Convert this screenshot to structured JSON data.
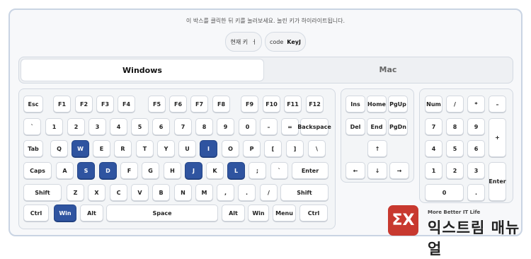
{
  "instruction": "이 박스를 클릭한 뒤 키를 눌러보세요. 눌린 키가 하이라이트됩니다.",
  "current_key_label": "현재 키",
  "current_key_value": "ㅓ",
  "code_label": "code",
  "code_value": "KeyJ",
  "tabs": {
    "active": "Windows",
    "inactive": "Mac"
  },
  "brand": {
    "logo_text": "ΣX",
    "tagline": "More Better IT Life",
    "name": "익스트림 매뉴얼"
  },
  "highlight_color": "#2f54a0",
  "main_keys": [
    {
      "label": "Esc",
      "name": "key-esc"
    },
    {
      "label": "F1",
      "name": "key-f1"
    },
    {
      "label": "F2",
      "name": "key-f2"
    },
    {
      "label": "F3",
      "name": "key-f3"
    },
    {
      "label": "F4",
      "name": "key-f4"
    },
    {
      "label": "F5",
      "name": "key-f5"
    },
    {
      "label": "F6",
      "name": "key-f6"
    },
    {
      "label": "F7",
      "name": "key-f7"
    },
    {
      "label": "F8",
      "name": "key-f8"
    },
    {
      "label": "F9",
      "name": "key-f9"
    },
    {
      "label": "F10",
      "name": "key-f10"
    },
    {
      "label": "F11",
      "name": "key-f11"
    },
    {
      "label": "F12",
      "name": "key-f12"
    },
    {
      "label": "`",
      "name": "key-backquote"
    },
    {
      "label": "1",
      "name": "key-1"
    },
    {
      "label": "2",
      "name": "key-2"
    },
    {
      "label": "3",
      "name": "key-3"
    },
    {
      "label": "4",
      "name": "key-4"
    },
    {
      "label": "5",
      "name": "key-5"
    },
    {
      "label": "6",
      "name": "key-6"
    },
    {
      "label": "7",
      "name": "key-7"
    },
    {
      "label": "8",
      "name": "key-8"
    },
    {
      "label": "9",
      "name": "key-9"
    },
    {
      "label": "0",
      "name": "key-0"
    },
    {
      "label": "–",
      "name": "key-minus"
    },
    {
      "label": "=",
      "name": "key-equal"
    },
    {
      "label": "Backspace",
      "name": "key-backspace"
    },
    {
      "label": "Tab",
      "name": "key-tab"
    },
    {
      "label": "Q",
      "name": "key-q"
    },
    {
      "label": "W",
      "name": "key-w",
      "highlight": true
    },
    {
      "label": "E",
      "name": "key-e"
    },
    {
      "label": "R",
      "name": "key-r"
    },
    {
      "label": "T",
      "name": "key-t"
    },
    {
      "label": "Y",
      "name": "key-y"
    },
    {
      "label": "U",
      "name": "key-u"
    },
    {
      "label": "I",
      "name": "key-i",
      "highlight": true
    },
    {
      "label": "O",
      "name": "key-o"
    },
    {
      "label": "P",
      "name": "key-p"
    },
    {
      "label": "[",
      "name": "key-bracket-left"
    },
    {
      "label": "]",
      "name": "key-bracket-right"
    },
    {
      "label": "\\",
      "name": "key-backslash"
    },
    {
      "label": "Caps",
      "name": "key-caps"
    },
    {
      "label": "A",
      "name": "key-a"
    },
    {
      "label": "S",
      "name": "key-s",
      "highlight": true
    },
    {
      "label": "D",
      "name": "key-d",
      "highlight": true
    },
    {
      "label": "F",
      "name": "key-f"
    },
    {
      "label": "G",
      "name": "key-g"
    },
    {
      "label": "H",
      "name": "key-h"
    },
    {
      "label": "J",
      "name": "key-j",
      "highlight": true
    },
    {
      "label": "K",
      "name": "key-k"
    },
    {
      "label": "L",
      "name": "key-l",
      "highlight": true
    },
    {
      "label": ";",
      "name": "key-semicolon"
    },
    {
      "label": "`",
      "name": "key-quote"
    },
    {
      "label": "Enter",
      "name": "key-enter"
    },
    {
      "label": "Shift",
      "name": "key-shift-left"
    },
    {
      "label": "Z",
      "name": "key-z"
    },
    {
      "label": "X",
      "name": "key-x"
    },
    {
      "label": "C",
      "name": "key-c"
    },
    {
      "label": "V",
      "name": "key-v"
    },
    {
      "label": "B",
      "name": "key-b"
    },
    {
      "label": "N",
      "name": "key-n"
    },
    {
      "label": "M",
      "name": "key-m"
    },
    {
      "label": ",",
      "name": "key-comma"
    },
    {
      "label": ".",
      "name": "key-period"
    },
    {
      "label": "/",
      "name": "key-slash"
    },
    {
      "label": "Shift",
      "name": "key-shift-right"
    },
    {
      "label": "Ctrl",
      "name": "key-ctrl-left"
    },
    {
      "label": "Win",
      "name": "key-win-left",
      "highlight": true
    },
    {
      "label": "Alt",
      "name": "key-alt-left"
    },
    {
      "label": "Space",
      "name": "key-space"
    },
    {
      "label": "Alt",
      "name": "key-alt-right"
    },
    {
      "label": "Win",
      "name": "key-win-right"
    },
    {
      "label": "Menu",
      "name": "key-menu"
    },
    {
      "label": "Ctrl",
      "name": "key-ctrl-right"
    }
  ],
  "nav_keys": [
    {
      "label": "Ins",
      "name": "key-insert"
    },
    {
      "label": "Home",
      "name": "key-home"
    },
    {
      "label": "PgUp",
      "name": "key-pgup"
    },
    {
      "label": "Del",
      "name": "key-delete"
    },
    {
      "label": "End",
      "name": "key-end"
    },
    {
      "label": "PgDn",
      "name": "key-pgdn"
    },
    {
      "label": "↑",
      "name": "key-arrow-up"
    },
    {
      "label": "←",
      "name": "key-arrow-left"
    },
    {
      "label": "↓",
      "name": "key-arrow-down"
    },
    {
      "label": "→",
      "name": "key-arrow-right"
    }
  ],
  "numpad_keys": [
    {
      "label": "Num",
      "name": "key-numlock"
    },
    {
      "label": "/",
      "name": "key-np-divide"
    },
    {
      "label": "*",
      "name": "key-np-multiply"
    },
    {
      "label": "–",
      "name": "key-np-minus"
    },
    {
      "label": "7",
      "name": "key-np-7"
    },
    {
      "label": "8",
      "name": "key-np-8"
    },
    {
      "label": "9",
      "name": "key-np-9"
    },
    {
      "label": "+",
      "name": "key-np-plus"
    },
    {
      "label": "4",
      "name": "key-np-4"
    },
    {
      "label": "5",
      "name": "key-np-5"
    },
    {
      "label": "6",
      "name": "key-np-6"
    },
    {
      "label": "1",
      "name": "key-np-1"
    },
    {
      "label": "2",
      "name": "key-np-2"
    },
    {
      "label": "3",
      "name": "key-np-3"
    },
    {
      "label": "Enter",
      "name": "key-np-enter"
    },
    {
      "label": "0",
      "name": "key-np-0"
    },
    {
      "label": ".",
      "name": "key-np-decimal"
    }
  ]
}
